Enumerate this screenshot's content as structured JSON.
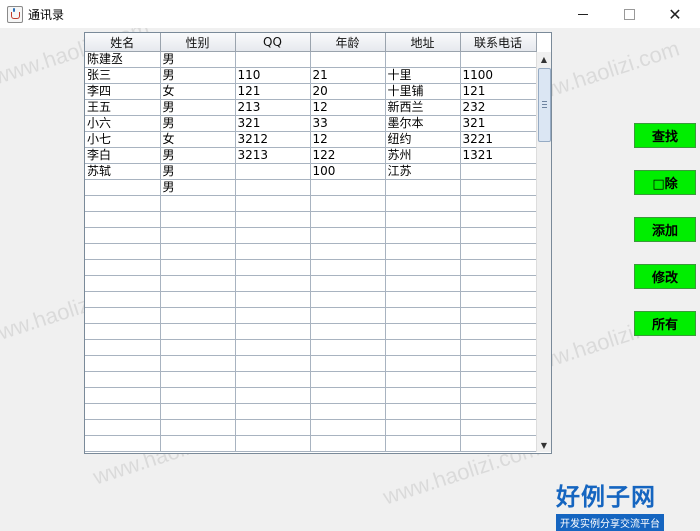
{
  "window": {
    "title": "通讯录",
    "minimize": "",
    "maximize": "",
    "close": "✕"
  },
  "table": {
    "headers": [
      "姓名",
      "性别",
      "QQ",
      "年龄",
      "地址",
      "联系电话"
    ],
    "rows": [
      [
        "陈建丞",
        "男",
        "",
        "",
        "",
        ""
      ],
      [
        "张三",
        "男",
        "110",
        "21",
        "十里",
        "1100"
      ],
      [
        "李四",
        "女",
        "121",
        "20",
        "十里铺",
        "121"
      ],
      [
        "王五",
        "男",
        "213",
        "12",
        "新西兰",
        "232"
      ],
      [
        "小六",
        "男",
        "321",
        "33",
        "墨尔本",
        "321"
      ],
      [
        "小七",
        "女",
        "3212",
        "12",
        "纽约",
        "3221"
      ],
      [
        "李白",
        "男",
        "3213",
        "122",
        "苏州",
        "1321"
      ],
      [
        "苏轼",
        "男",
        "",
        "100",
        "江苏",
        ""
      ],
      [
        "",
        "男",
        "",
        "",
        "",
        ""
      ]
    ],
    "empty_rows": 16
  },
  "buttons": {
    "search": "查找",
    "delete": "□除",
    "add": "添加",
    "modify": "修改",
    "all": "所有"
  },
  "watermark": {
    "text": "www.haolizi.com",
    "brand": "好例子网",
    "brand_sub": "开发实例分享交流平台"
  },
  "colors": {
    "button_green": "#00ee00",
    "brand_blue": "#1565c0"
  },
  "icons": {
    "app": "java-cup-icon",
    "scroll_up": "▲",
    "scroll_down": "▼"
  }
}
